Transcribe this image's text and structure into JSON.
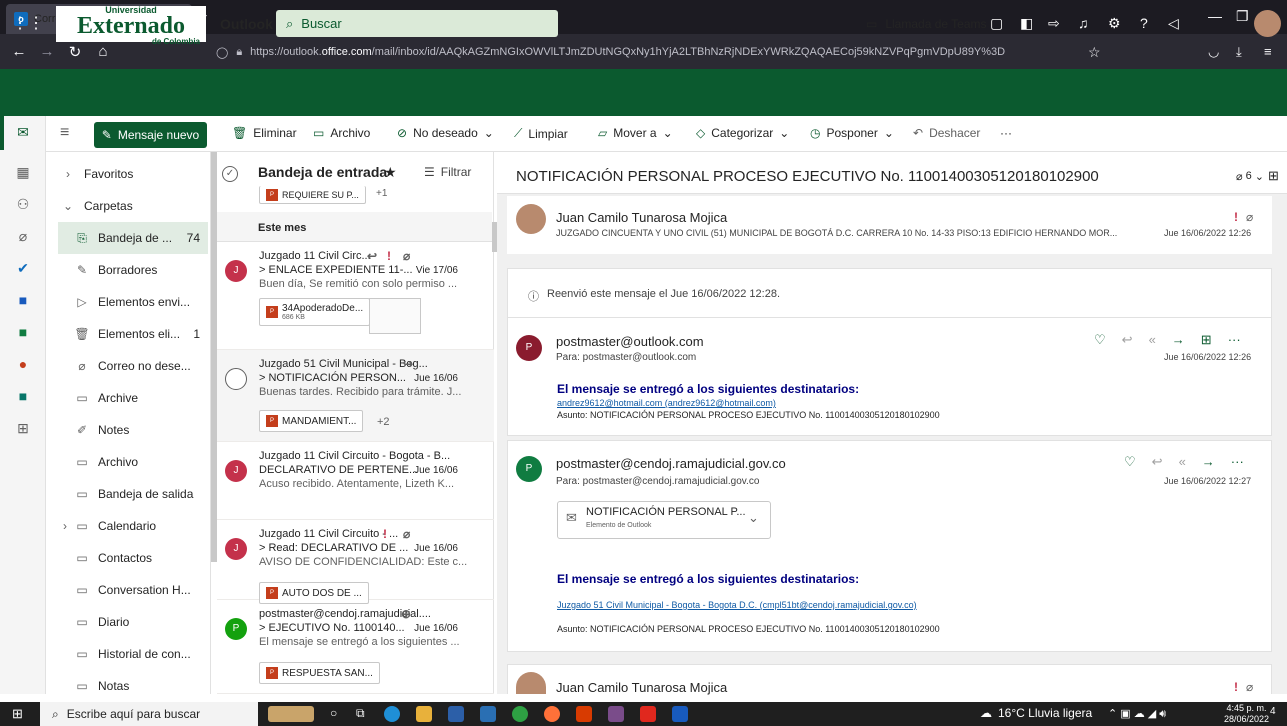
{
  "browser": {
    "tab_title": "Correo: Juan Camilo Tunarosa",
    "url_prefix": "https://outlook.",
    "url_domain": "office.com",
    "url_path": "/mail/inbox/id/AAQkAGZmNGIxOWVlLTJmZDUtNGQxNy1hYjA2LTBhNzRjNDExYWRkZQAQAECoj59kNZVPqPgmVDpU89Y%3D"
  },
  "header": {
    "logo_top": "Universidad",
    "logo_main": "Externado",
    "logo_bottom": "de Colombia",
    "app_name": "Outlook",
    "search_placeholder": "Buscar",
    "teams_call": "Llamada de Teams"
  },
  "command_bar": {
    "new_mail": "Mensaje nuevo",
    "delete": "Eliminar",
    "archive": "Archivo",
    "junk": "No deseado",
    "sweep": "Limpiar",
    "move": "Mover a",
    "categorize": "Categorizar",
    "snooze": "Posponer",
    "undo": "Deshacer",
    "more": "···"
  },
  "folders": {
    "favorites": "Favoritos",
    "folders_group": "Carpetas",
    "items": [
      {
        "label": "Bandeja de ...",
        "count": "74"
      },
      {
        "label": "Borradores",
        "count": ""
      },
      {
        "label": "Elementos envi...",
        "count": ""
      },
      {
        "label": "Elementos eli...",
        "count": "1"
      },
      {
        "label": "Correo no dese...",
        "count": ""
      },
      {
        "label": "Archive",
        "count": ""
      },
      {
        "label": "Notes",
        "count": ""
      },
      {
        "label": "Archivo",
        "count": ""
      },
      {
        "label": "Bandeja de salida",
        "count": ""
      },
      {
        "label": "Calendario",
        "count": ""
      },
      {
        "label": "Contactos",
        "count": ""
      },
      {
        "label": "Conversation H...",
        "count": ""
      },
      {
        "label": "Diario",
        "count": ""
      },
      {
        "label": "Historial de con...",
        "count": ""
      },
      {
        "label": "Notas",
        "count": ""
      }
    ]
  },
  "message_list": {
    "title": "Bandeja de entrada",
    "filter": "Filtrar",
    "partial_chip": "REQUIERE SU P...",
    "partial_more": "+1",
    "section": "Este mes",
    "messages": [
      {
        "initial": "J",
        "from": "Juzgado 11 Civil Circ...",
        "subject": "> ENLACE EXPEDIENTE 11-...",
        "date": "Vie 17/06",
        "preview": "Buen día, Se remitió con solo permiso ...",
        "chip": "34ApoderadoDe...",
        "chip_size": "686 KB"
      },
      {
        "initial": "",
        "from": "Juzgado 51 Civil Municipal - Bog...",
        "subject": "> NOTIFICACIÓN PERSON...",
        "date": "Jue 16/06",
        "preview": "Buenas tardes. Recibido para trámite. J...",
        "chip": "MANDAMIENT...",
        "more": "+2"
      },
      {
        "initial": "J",
        "from": "Juzgado 11 Civil Circuito - Bogota - B...",
        "subject": "DECLARATIVO DE PERTENE...",
        "date": "Jue 16/06",
        "preview": "Acuso recibido. Atentamente, Lizeth K..."
      },
      {
        "initial": "J",
        "from": "Juzgado 11 Civil Circuito - ...",
        "subject": "> Read: DECLARATIVO DE ...",
        "date": "Jue 16/06",
        "preview": "AVISO DE CONFIDENCIALIDAD: Este c...",
        "chip": "AUTO DOS DE ..."
      },
      {
        "initial": "P",
        "from": "postmaster@cendoj.ramajudicial....",
        "subject": "> EJECUTIVO No. 1100140...",
        "date": "Jue 16/06",
        "preview": "El mensaje se entregó a los siguientes ...",
        "chip": "RESPUESTA SAN..."
      }
    ]
  },
  "reading": {
    "subject": "NOTIFICACIÓN PERSONAL PROCESO EJECUTIVO No. 11001400305120180102900",
    "count": "6",
    "first": {
      "sender": "Juan Camilo Tunarosa Mojica",
      "snippet": "JUZGADO CINCUENTA Y UNO CIVIL (51) MUNICIPAL DE BOGOTÁ D.C. CARRERA 10 No. 14-33 PISO:13 EDIFICIO HERNANDO MOR...",
      "date": "Jue 16/06/2022 12:26"
    },
    "forwarded": "Reenvió este mensaje el Jue 16/06/2022 12:28.",
    "msg1": {
      "initial": "P",
      "sender": "postmaster@outlook.com",
      "to": "Para:  postmaster@outlook.com",
      "date": "Jue 16/06/2022 12:26",
      "heading": "El mensaje se entregó a los siguientes destinatarios:",
      "recipient": "andrez9612@hotmail.com (andrez9612@hotmail.com)",
      "asunto": "Asunto: NOTIFICACIÓN PERSONAL PROCESO EJECUTIVO No. 11001400305120180102900"
    },
    "msg2": {
      "initial": "P",
      "sender": "postmaster@cendoj.ramajudicial.gov.co",
      "to": "Para:  postmaster@cendoj.ramajudicial.gov.co",
      "date": "Jue 16/06/2022 12:27",
      "attachment": "NOTIFICACIÓN PERSONAL P...",
      "attachment_type": "Elemento de Outlook",
      "heading": "El mensaje se entregó a los siguientes destinatarios:",
      "recipient": "Juzgado 51 Civil Municipal - Bogota - Bogota D.C. (cmpl51bt@cendoj.ramajudicial.gov.co)",
      "asunto": "Asunto: NOTIFICACIÓN PERSONAL PROCESO EJECUTIVO No. 11001400305120180102900"
    },
    "last": {
      "sender": "Juan Camilo Tunarosa Mojica"
    }
  },
  "taskbar": {
    "search": "Escribe aquí para buscar",
    "weather": "16°C  Lluvia ligera",
    "time": "4:45 p. m.",
    "date": "28/06/2022",
    "notif": "4"
  }
}
